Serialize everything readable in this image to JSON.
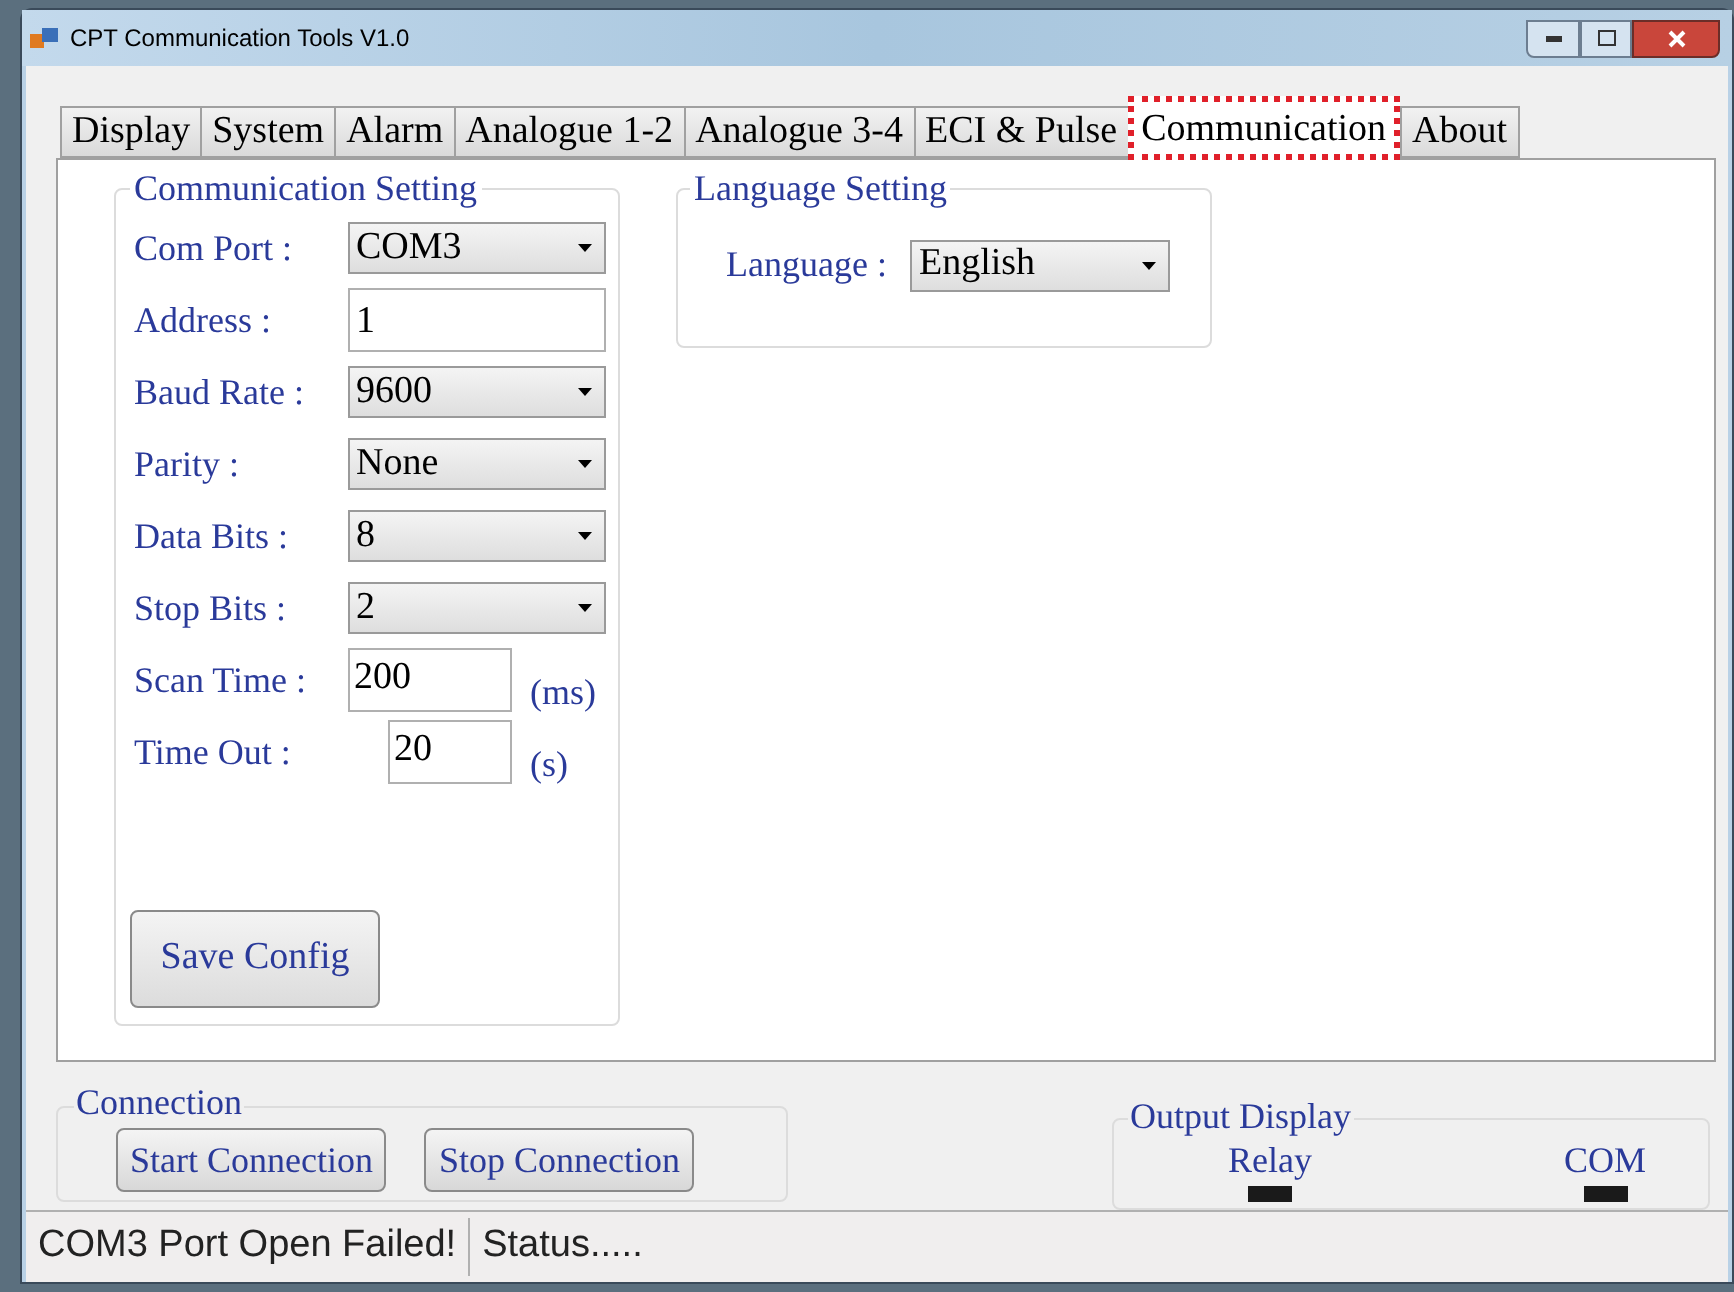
{
  "window": {
    "title": "CPT Communication Tools V1.0"
  },
  "tabs": [
    {
      "label": "Display",
      "selected": false
    },
    {
      "label": "System",
      "selected": false
    },
    {
      "label": "Alarm",
      "selected": false
    },
    {
      "label": "Analogue 1-2",
      "selected": false
    },
    {
      "label": "Analogue 3-4",
      "selected": false
    },
    {
      "label": "ECI & Pulse",
      "selected": false
    },
    {
      "label": "Communication",
      "selected": true
    },
    {
      "label": "About",
      "selected": false
    }
  ],
  "communication_setting": {
    "title": "Communication Setting",
    "fields": [
      {
        "label": "Com Port :",
        "kind": "dropdown",
        "value": "COM3"
      },
      {
        "label": "Address :",
        "kind": "text",
        "value": "1"
      },
      {
        "label": "Baud Rate :",
        "kind": "dropdown",
        "value": "9600"
      },
      {
        "label": "Parity :",
        "kind": "dropdown",
        "value": "None"
      },
      {
        "label": "Data Bits :",
        "kind": "dropdown",
        "value": "8"
      },
      {
        "label": "Stop Bits :",
        "kind": "dropdown",
        "value": "2"
      },
      {
        "label": "Scan Time :",
        "kind": "short",
        "value": "200",
        "unit": "(ms)"
      },
      {
        "label": "Time Out :",
        "kind": "tiny",
        "value": "20",
        "unit": "(s)"
      }
    ],
    "save_button": "Save Config"
  },
  "language_setting": {
    "title": "Language Setting",
    "label": "Language :",
    "value": "English"
  },
  "connection": {
    "title": "Connection",
    "buttons": [
      "Start Connection",
      "Stop Connection"
    ]
  },
  "output_display": {
    "title": "Output Display",
    "indicators": [
      {
        "label": "Relay"
      },
      {
        "label": "COM"
      }
    ]
  },
  "status_bar": [
    "COM3 Port Open Failed!",
    "Status....."
  ]
}
